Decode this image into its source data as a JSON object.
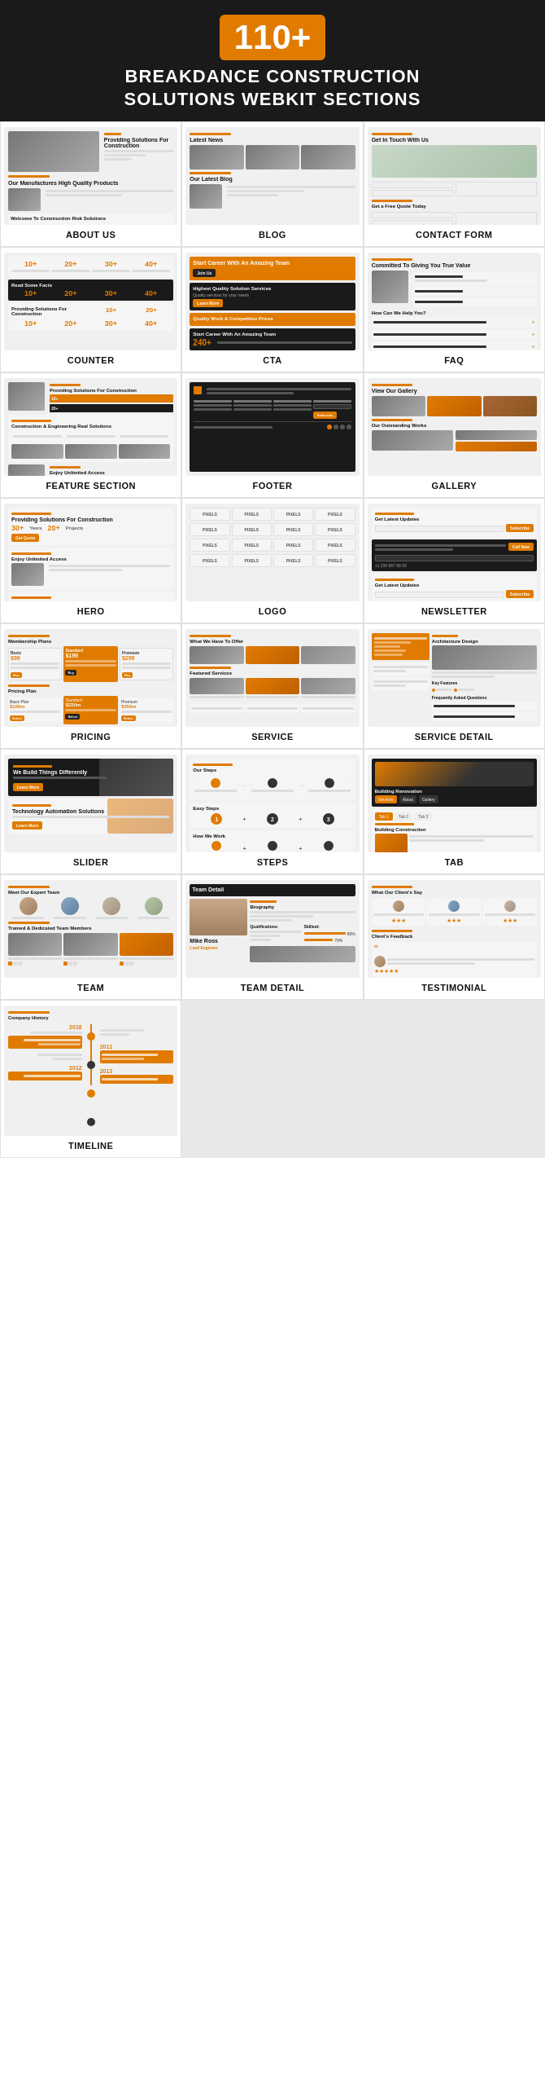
{
  "header": {
    "number": "110+",
    "title_line1": "BREAKDANCE CONSTRUCTION",
    "title_line2": "SOLUTIONS WEBKIT SECTIONS"
  },
  "sections": [
    {
      "id": "about-us",
      "label": "ABOUT US"
    },
    {
      "id": "blog",
      "label": "BLOG"
    },
    {
      "id": "contact-form",
      "label": "CONTACT FORM"
    },
    {
      "id": "counter",
      "label": "COUNTER"
    },
    {
      "id": "cta",
      "label": "CTA"
    },
    {
      "id": "faq",
      "label": "FAQ"
    },
    {
      "id": "feature-section",
      "label": "FEATURE SECTION"
    },
    {
      "id": "footer",
      "label": "FOOTER"
    },
    {
      "id": "gallery",
      "label": "GALLERY"
    },
    {
      "id": "hero",
      "label": "HERO"
    },
    {
      "id": "logo",
      "label": "LOGO"
    },
    {
      "id": "newsletter",
      "label": "NEWSLETTER"
    },
    {
      "id": "pricing",
      "label": "PRICING"
    },
    {
      "id": "service",
      "label": "SERVICE"
    },
    {
      "id": "service-detail",
      "label": "SERVICE DETAIL"
    },
    {
      "id": "slider",
      "label": "SLIDER"
    },
    {
      "id": "steps",
      "label": "STEPS"
    },
    {
      "id": "tab",
      "label": "TAB"
    },
    {
      "id": "team",
      "label": "TEAM"
    },
    {
      "id": "team-detail",
      "label": "TEAM DETAIL"
    },
    {
      "id": "testimonial",
      "label": "TESTIMONIAL"
    },
    {
      "id": "timeline",
      "label": "TIMELINE"
    }
  ]
}
